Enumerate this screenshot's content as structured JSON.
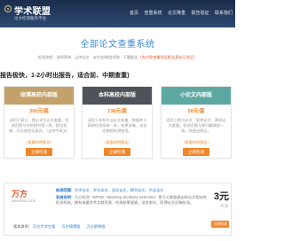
{
  "header": {
    "logo_title": "学术联盟",
    "logo_subtitle": "论文检测服务平台",
    "nav": [
      {
        "label": "首页"
      },
      {
        "label": "查重系统"
      },
      {
        "label": "论文降重"
      },
      {
        "label": "报告验证"
      },
      {
        "label": "联系我们"
      }
    ]
  },
  "main": {
    "title": "全部论文查重系统",
    "process_label": "检测流程：",
    "process_steps": "选择系统 · 上传论文 · 支付宝/微信付款 · 下载报告",
    "process_note": "（先付款查重保证报告真实可验证）",
    "speed_note": "报告极快，1-2小时出报告，适合前、中期查重)"
  },
  "cards": [
    {
      "title": "硕博高校内部版",
      "price": "360元/篇",
      "desc": "适用于硕士、博士学位论文查重，检测范围与学校图书馆一致，报告权威，可在线验证真伪。（支持中英文）",
      "link": "（查看样例报告）",
      "button": "立即检测"
    },
    {
      "title": "本科高校内部版",
      "price": "138元/篇",
      "desc": "适用于本科毕业论文查重，数据库与高校检测系统一致，结果准确，适合定稿前检测使用。",
      "link": "（查看样例报告）",
      "button": "立即检测"
    },
    {
      "title": "小论文内部版",
      "price": "58元/篇",
      "desc": "适用于期刊论文、职称论文、课程论文查重，检测范围与期刊编辑部一致，快速出报告。",
      "link": "（查看样例报告）",
      "button": "立即检测"
    }
  ],
  "panel": {
    "logo_name": "万方",
    "logo_sub": "WANFANG DATA",
    "range_label": "检测范围：",
    "range_text": "大学论文、学位论文、会议论文、期刊论文、毕业论文",
    "desc_label": "系统说明：",
    "desc_text": "万方检测（WFSD / Wanfang Similarity Detection）是万方数据推出的论文相似性检测系统，拥有海量学术文献资源，检测结果准确，适合本科、硕博论文初稿检测。",
    "version_label": "版本说明：",
    "versions": [
      "万方大学生版",
      "万方硕博版",
      "万方职称版"
    ],
    "price": "3元",
    "price_unit": "/千字",
    "button": "立即检测"
  },
  "colors": {
    "card1_head": "#c3a16b",
    "card2_head": "#4d5358",
    "card3_head": "#5ea8a2",
    "accent": "#f0862a",
    "title": "#3a8ad6",
    "link": "#2b77c9"
  }
}
